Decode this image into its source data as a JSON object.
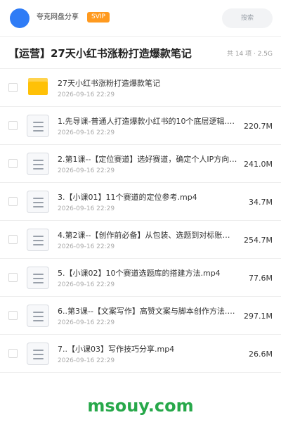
{
  "header": {
    "user_name": "夸克网盘分享",
    "badge": "SVIP",
    "search_placeholder": "搜索",
    "avatar_color": "#2f7cf6",
    "badge_color": "#ff9a1f"
  },
  "folder": {
    "title": "【运营】27天小红书涨粉打造爆款笔记",
    "meta": "共 14 项 · 2.5G"
  },
  "files": [
    {
      "icon": "folder-icon",
      "name": "27天小红书涨粉打造爆款笔记",
      "date": "2026-09-16 22:29",
      "size": ""
    },
    {
      "icon": "document-icon",
      "name": "1.先导课-普通人打造爆款小红书的10个底层逻辑.mp4",
      "date": "2026-09-16 22:29",
      "size": "220.7M"
    },
    {
      "icon": "document-icon",
      "name": "2.第1课--【定位赛道】选好赛道，确定个人IP方向.mp4",
      "date": "2026-09-16 22:29",
      "size": "241.0M"
    },
    {
      "icon": "document-icon",
      "name": "3.【小课01】11个赛道的定位参考.mp4",
      "date": "2026-09-16 22:29",
      "size": "34.7M"
    },
    {
      "icon": "document-icon",
      "name": "4.第2课--【创作前必备】从包装、选题到对标账号.mp4",
      "date": "2026-09-16 22:29",
      "size": "254.7M"
    },
    {
      "icon": "document-icon",
      "name": "5.【小课02】10个赛道选题库的搭建方法.mp4",
      "date": "2026-09-16 22:29",
      "size": "77.6M"
    },
    {
      "icon": "document-icon",
      "name": "6..第3课--【文案写作】高赞文案与脚本创作方法.mp4",
      "date": "2026-09-16 22:29",
      "size": "297.1M"
    },
    {
      "icon": "document-icon",
      "name": "7..【小课03】写作技巧分享.mp4",
      "date": "2026-09-16 22:29",
      "size": "26.6M"
    }
  ],
  "watermark": "msouy.com",
  "colors": {
    "watermark": "#27a84a",
    "folder": "#ffc107"
  }
}
